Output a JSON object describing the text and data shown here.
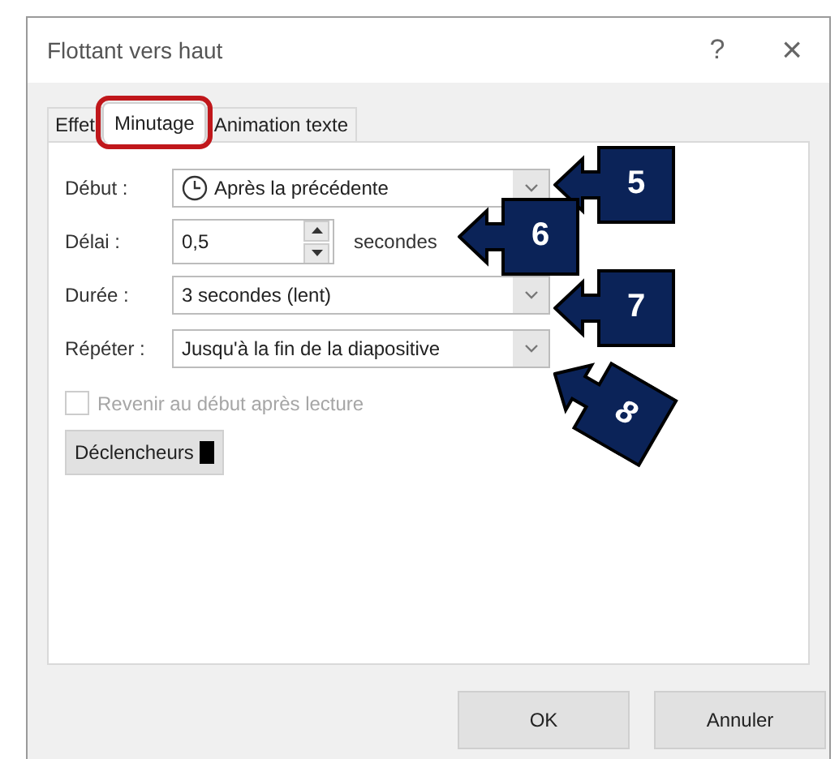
{
  "window": {
    "title": "Flottant vers haut",
    "help": "?",
    "close": "×"
  },
  "tabs": [
    {
      "label": "Effet",
      "selected": false,
      "highlighted": false
    },
    {
      "label": "Minutage",
      "selected": true,
      "highlighted": true
    },
    {
      "label": "Animation texte",
      "selected": false,
      "highlighted": false
    }
  ],
  "fields": [
    {
      "kind": "combo",
      "label": "Début :",
      "value": "Après la précédente"
    },
    {
      "kind": "spin",
      "label": "Délai :",
      "value": "0,5",
      "unit": "secondes"
    },
    {
      "kind": "combo",
      "label": "Durée :",
      "value": "3 secondes (lent)"
    },
    {
      "kind": "combo",
      "label": "Répéter :",
      "value": "Jusqu'à la fin de la diapositive"
    }
  ],
  "rewind": {
    "label": "Revenir au début après lecture",
    "checked": false,
    "disabled": true
  },
  "triggers_button": "Déclencheurs",
  "buttons": [
    "OK",
    "Annuler"
  ],
  "callouts": [
    {
      "label": "5",
      "tilted": false
    },
    {
      "label": "6",
      "tilted": false
    },
    {
      "label": "7",
      "tilted": false
    },
    {
      "label": "8",
      "tilted": true
    }
  ]
}
